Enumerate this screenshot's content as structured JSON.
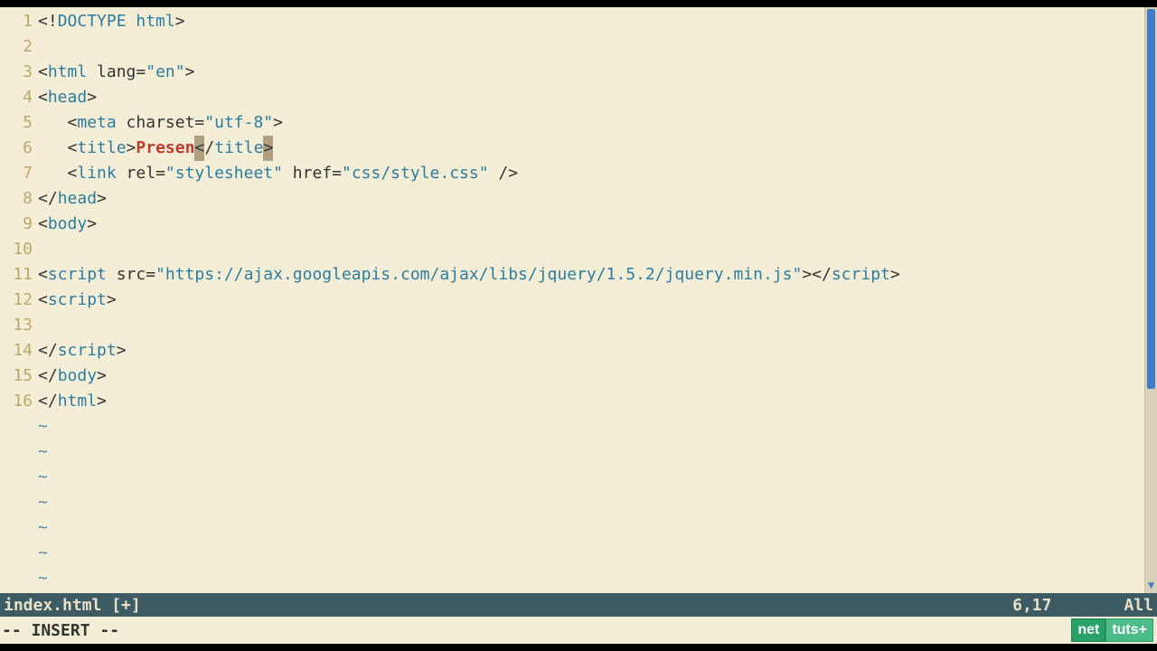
{
  "editor": {
    "lines": [
      {
        "num": "1",
        "tokens": [
          [
            "angle",
            "<!"
          ],
          [
            "tag",
            "DOCTYPE html"
          ],
          [
            "angle",
            ">"
          ]
        ]
      },
      {
        "num": "2",
        "tokens": []
      },
      {
        "num": "3",
        "tokens": [
          [
            "angle",
            "<"
          ],
          [
            "tag",
            "html"
          ],
          [
            "attr",
            " lang="
          ],
          [
            "str",
            "\"en\""
          ],
          [
            "angle",
            ">"
          ]
        ]
      },
      {
        "num": "4",
        "tokens": [
          [
            "angle",
            "<"
          ],
          [
            "tag",
            "head"
          ],
          [
            "angle",
            ">"
          ]
        ]
      },
      {
        "num": "5",
        "tokens": [
          [
            "attr",
            "   "
          ],
          [
            "angle",
            "<"
          ],
          [
            "tag",
            "meta"
          ],
          [
            "attr",
            " charset="
          ],
          [
            "str",
            "\"utf-8\""
          ],
          [
            "angle",
            ">"
          ]
        ]
      },
      {
        "num": "6",
        "tokens": [
          [
            "attr",
            "   "
          ],
          [
            "angle",
            "<"
          ],
          [
            "tag",
            "title"
          ],
          [
            "angle",
            ">"
          ],
          [
            "err",
            "Presen"
          ],
          [
            "hlchar",
            "<"
          ],
          [
            "attr",
            "/"
          ],
          [
            "tag",
            "title"
          ],
          [
            "hlchar",
            ">"
          ]
        ]
      },
      {
        "num": "7",
        "tokens": [
          [
            "attr",
            "   "
          ],
          [
            "angle",
            "<"
          ],
          [
            "tag",
            "link"
          ],
          [
            "attr",
            " rel="
          ],
          [
            "str",
            "\"stylesheet\""
          ],
          [
            "attr",
            " href="
          ],
          [
            "str",
            "\"css/style.css\""
          ],
          [
            "attr",
            " /"
          ],
          [
            "angle",
            ">"
          ]
        ]
      },
      {
        "num": "8",
        "tokens": [
          [
            "angle",
            "</"
          ],
          [
            "tag",
            "head"
          ],
          [
            "angle",
            ">"
          ]
        ]
      },
      {
        "num": "9",
        "tokens": [
          [
            "angle",
            "<"
          ],
          [
            "tag",
            "body"
          ],
          [
            "angle",
            ">"
          ]
        ]
      },
      {
        "num": "10",
        "tokens": []
      },
      {
        "num": "11",
        "tokens": [
          [
            "angle",
            "<"
          ],
          [
            "tag",
            "script"
          ],
          [
            "attr",
            " src="
          ],
          [
            "str",
            "\"https://ajax.googleapis.com/ajax/libs/jquery/1.5.2/jquery.min.js\""
          ],
          [
            "angle",
            ">"
          ],
          [
            "angle",
            "</"
          ],
          [
            "tag",
            "script"
          ],
          [
            "angle",
            ">"
          ]
        ]
      },
      {
        "num": "12",
        "tokens": [
          [
            "angle",
            "<"
          ],
          [
            "tag",
            "script"
          ],
          [
            "angle",
            ">"
          ]
        ]
      },
      {
        "num": "13",
        "tokens": []
      },
      {
        "num": "14",
        "tokens": [
          [
            "angle",
            "</"
          ],
          [
            "tag",
            "script"
          ],
          [
            "angle",
            ">"
          ]
        ]
      },
      {
        "num": "15",
        "tokens": [
          [
            "angle",
            "</"
          ],
          [
            "tag",
            "body"
          ],
          [
            "angle",
            ">"
          ]
        ]
      },
      {
        "num": "16",
        "tokens": [
          [
            "angle",
            "</"
          ],
          [
            "tag",
            "html"
          ],
          [
            "angle",
            ">"
          ]
        ]
      }
    ],
    "tilde": "~",
    "tilde_count": 7
  },
  "status": {
    "filename": "index.html [+]",
    "position": "6,17",
    "scroll": "All"
  },
  "cmd": {
    "mode": "-- INSERT --"
  },
  "logo": {
    "left": "net",
    "right": "tuts+"
  }
}
